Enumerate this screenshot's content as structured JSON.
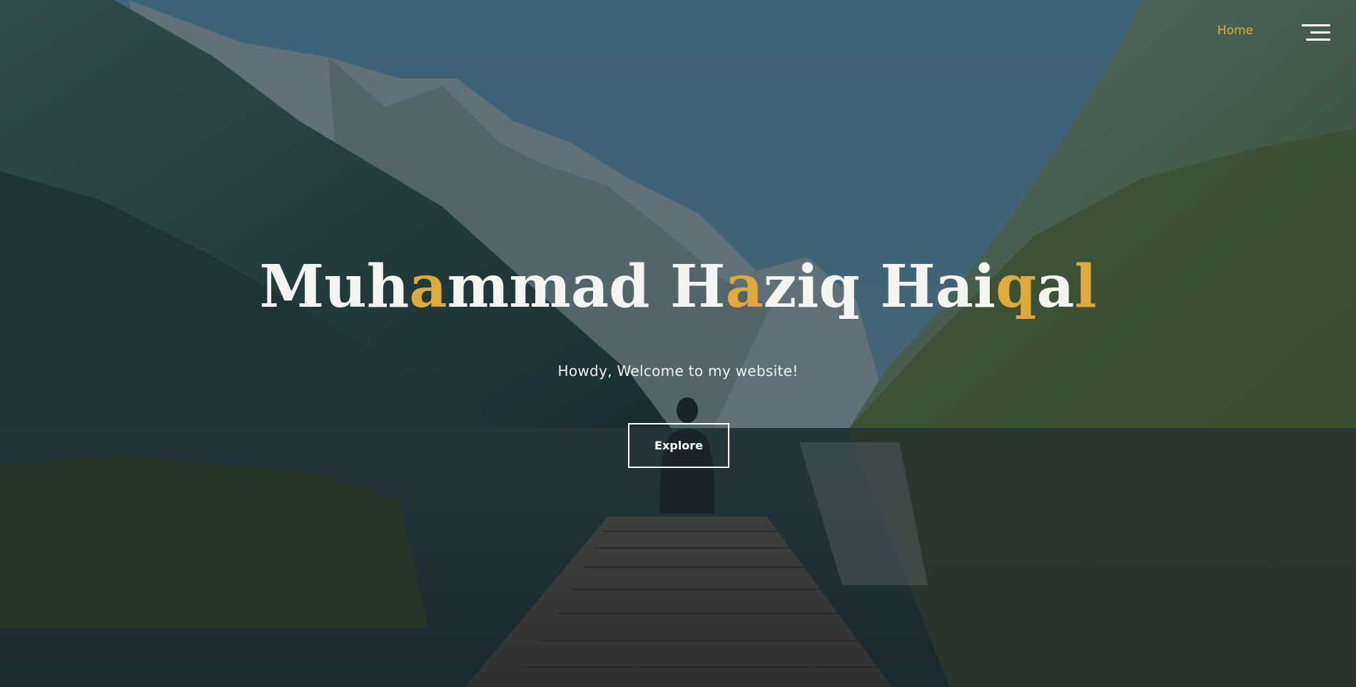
{
  "nav": {
    "home_label": "Home",
    "menu_icon": "hamburger-menu-icon"
  },
  "hero": {
    "title_segments": [
      {
        "text": "Muh",
        "highlight": false
      },
      {
        "text": "a",
        "highlight": true
      },
      {
        "text": "mmad H",
        "highlight": false
      },
      {
        "text": "a",
        "highlight": true
      },
      {
        "text": "ziq Hai",
        "highlight": false
      },
      {
        "text": "q",
        "highlight": true
      },
      {
        "text": "a",
        "highlight": false
      },
      {
        "text": "l",
        "highlight": true
      }
    ],
    "subtitle": "Howdy, Welcome to my website!",
    "button_label": "Explore",
    "background": "mountain-lake-dock-photo"
  },
  "colors": {
    "accent": "#e0a93b",
    "text": "#f4f4f1",
    "overlay": "#1f3a4a"
  }
}
